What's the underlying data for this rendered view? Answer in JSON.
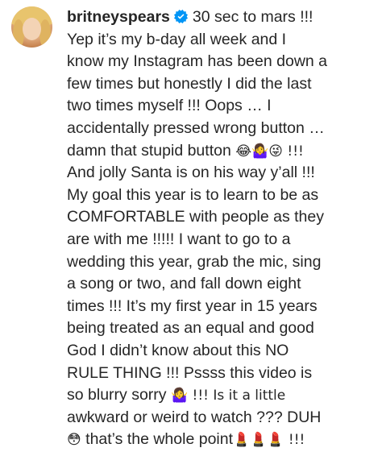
{
  "post": {
    "username": "britneyspears",
    "avatar_icon": "profile-photo",
    "verified_icon": "verified-badge-icon",
    "verified_color": "#0095f6",
    "caption_lines": [
      "30 sec to mars !!!",
      "Yep it’s my b-day all week and I",
      "know my Instagram has been down a",
      "few times but honestly I did the last",
      "two times myself !!! Oops … I",
      "accidentally pressed wrong button …",
      "damn that stupid button",
      "😂🤷‍♀️😜 !!!",
      "And jolly Santa is on his way y’all !!!",
      "My goal this year is to learn to be as",
      "COMFORTABLE with people as they",
      "are with me !!!!! I want to go to a",
      "wedding this year, grab the mic, sing",
      "a song or two, and fall down eight",
      "times !!! It’s my first year in 15 years",
      "being treated as an equal and good",
      "God I didn’t know about this NO",
      "RULE THING !!! Pssss this video is",
      "so blurry sorry",
      "🤷‍♀️ !!! Is it a little",
      "awkward or weird to watch ??? DUH",
      "😳",
      "that’s the whole point",
      "💄💄💄 !!!"
    ]
  }
}
